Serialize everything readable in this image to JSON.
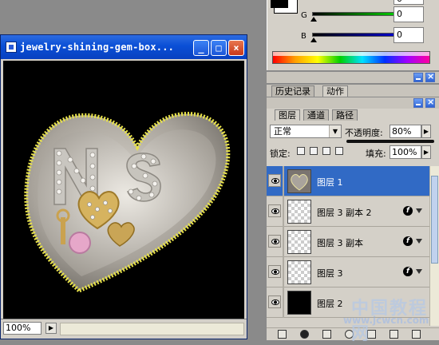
{
  "document_window": {
    "title": "jewelry-shining-gem-box...",
    "zoom": "100%",
    "controls": {
      "minimize": "_",
      "maximize": "□",
      "close": "×"
    }
  },
  "color_panel": {
    "channels": [
      {
        "label": "G",
        "value": "0",
        "color": "#00c000"
      },
      {
        "label": "B",
        "value": "0",
        "color": "#0000c0"
      }
    ],
    "partial_value": "0"
  },
  "history_panel": {
    "tabs": [
      "历史记录",
      "动作"
    ],
    "active_tab": "动作"
  },
  "layers_panel": {
    "tabs": [
      "图层",
      "通道",
      "路径"
    ],
    "active_tab": "图层",
    "blend_mode": "正常",
    "opacity_label": "不透明度:",
    "opacity_value": "80%",
    "lock_label": "锁定:",
    "fill_label": "填充:",
    "fill_value": "100%",
    "layers": [
      {
        "name": "图层 1",
        "selected": true,
        "thumb": "heart",
        "fx": false
      },
      {
        "name": "图层 3 副本 2",
        "selected": false,
        "thumb": "transparent",
        "fx": true
      },
      {
        "name": "图层 3 副本",
        "selected": false,
        "thumb": "transparent",
        "fx": true
      },
      {
        "name": "图层 3",
        "selected": false,
        "thumb": "transparent",
        "fx": true
      },
      {
        "name": "图层 2",
        "selected": false,
        "thumb": "black",
        "fx": false
      }
    ]
  },
  "watermark": {
    "text": "中国教程网",
    "url": "www.jcwcn.com"
  }
}
